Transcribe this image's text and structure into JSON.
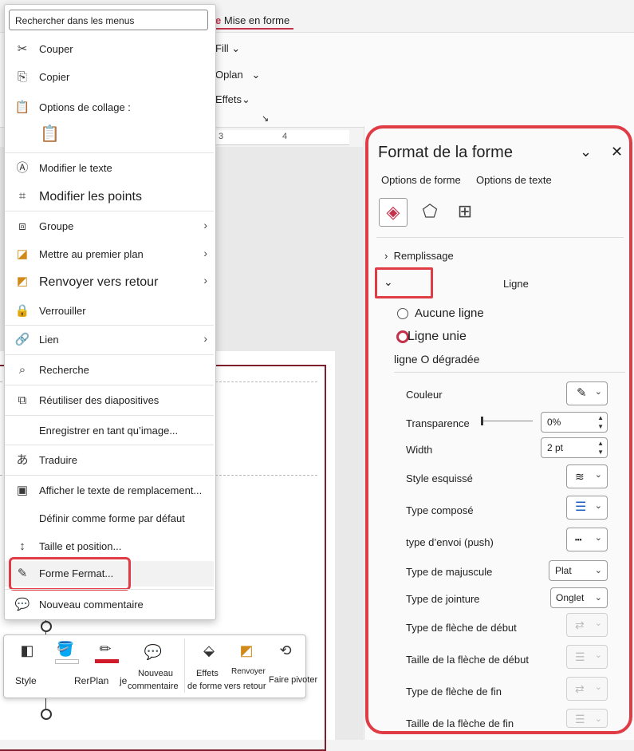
{
  "ribbon": {
    "active_tab_prefix": "e",
    "active_tab": "Mise en forme",
    "items": {
      "fill": "Fill",
      "plan": "Oplan",
      "effets": "Effets"
    },
    "ruler_marks": {
      "r3": "3",
      "r4": "4"
    }
  },
  "context_menu": {
    "search_placeholder": "Rechercher dans les menus",
    "items": {
      "couper": "Couper",
      "copier": "Copier",
      "options_collage": "Options de collage :",
      "modifier_texte": "Modifier le texte",
      "modifier_points": "Modifier les points",
      "groupe": "Groupe",
      "premier_plan": "Mettre au premier plan",
      "renvoyer": "Renvoyer vers retour",
      "verrouiller": "Verrouiller",
      "lien": "Lien",
      "recherche": "Recherche",
      "reutiliser": "Réutiliser des diapositives",
      "enregistrer": "Enregistrer en tant qu’image...",
      "traduire": "Traduire",
      "afficher_texte": "Afficher le texte de remplacement...",
      "definir_forme": "Définir comme forme par défaut",
      "taille_position": "Taille et position...",
      "forme_format": "Forme Fermat...",
      "nouveau_commentaire": "Nouveau commentaire"
    }
  },
  "mini_toolbar": {
    "style": "Style",
    "rerplan": "RerPlan",
    "je": "je",
    "nouveau1": "Nouveau",
    "nouveau2": "commentaire",
    "effets1": "Effets",
    "effets2": "de forme",
    "renvoyer1": "Renvoyer",
    "renvoyer2": "vers retour",
    "faire_pivoter": "Faire pivoter"
  },
  "format_pane": {
    "title": "Format de la forme",
    "tab_forme": "Options de forme",
    "tab_texte": "Options de texte",
    "remplissage": "Remplissage",
    "ligne": "Ligne",
    "aucune_ligne": "Aucune ligne",
    "ligne_unie": "Ligne unie",
    "ligne_degradee": "ligne O dégradée",
    "labels": {
      "couleur": "Couleur",
      "transparence": "Transparence",
      "width": "Width",
      "style_esquisse": "Style esquissé",
      "type_compose": "Type composé",
      "type_envoi": "type d’envoi (push)",
      "type_majuscule": "Type de majuscule",
      "type_jointure": "Type de jointure",
      "fleche_debut_type": "Type de flèche de début",
      "fleche_debut_taille": "Taille de la flèche de début",
      "fleche_fin_type": "Type de flèche de fin",
      "fleche_fin_taille": "Taille de la flèche de fin"
    },
    "values": {
      "transparence": "0%",
      "width": "2 pt",
      "majuscule": "Plat",
      "jointure": "Onglet"
    },
    "accent_color": "#c4314b",
    "highlight_color": "#e03c46"
  }
}
